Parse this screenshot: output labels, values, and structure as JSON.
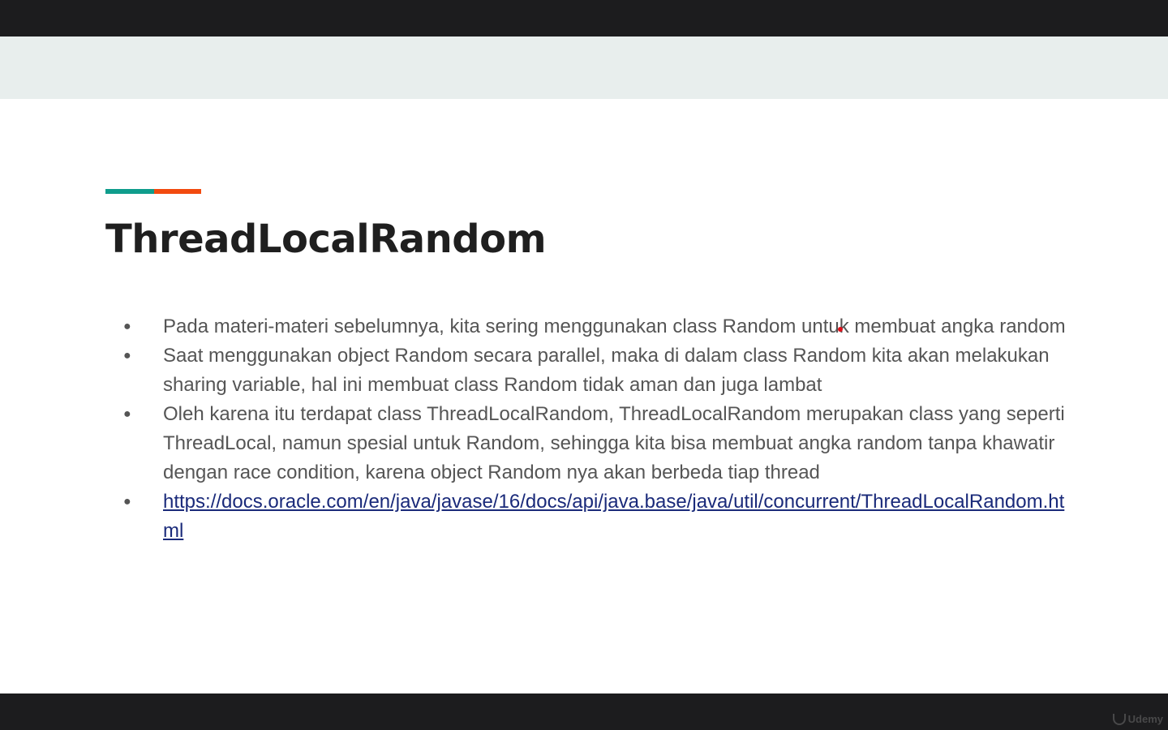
{
  "slide": {
    "title": "ThreadLocalRandom",
    "accent_colors": [
      "#0f9d8c",
      "#f24a0f"
    ],
    "bullets": [
      {
        "text": "Pada materi-materi sebelumnya, kita sering menggunakan class Random untuk membuat angka random"
      },
      {
        "text": "Saat menggunakan object Random secara parallel, maka di dalam class Random kita akan melakukan sharing variable, hal ini membuat class Random tidak aman dan juga lambat"
      },
      {
        "text": "Oleh karena itu terdapat class ThreadLocalRandom, ThreadLocalRandom merupakan class yang seperti ThreadLocal, namun spesial untuk Random, sehingga kita bisa membuat angka random tanpa khawatir dengan race condition, karena object Random nya akan berbeda tiap thread"
      },
      {
        "link": "https://docs.oracle.com/en/java/javase/16/docs/api/java.base/java/util/concurrent/ThreadLocalRandom.html"
      }
    ],
    "bullet_symbol": "●"
  },
  "watermark": {
    "label": "Udemy"
  }
}
